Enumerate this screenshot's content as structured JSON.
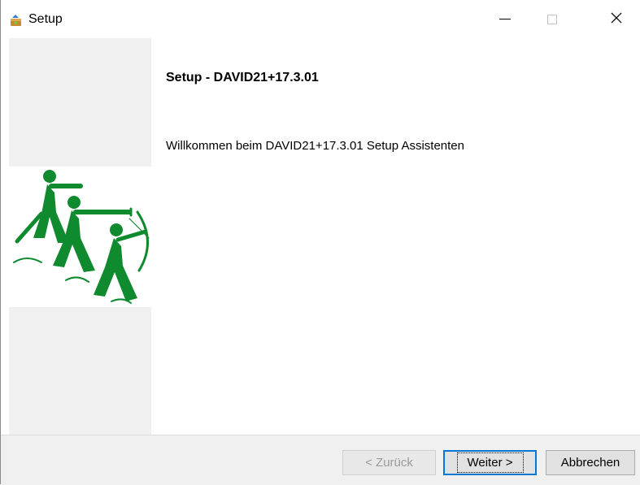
{
  "window": {
    "title": "Setup",
    "icon": "setup-app-icon",
    "controls": {
      "minimize": "minimize-icon",
      "maximize": "maximize-icon",
      "close": "close-icon",
      "close_glyph": "✕"
    }
  },
  "main": {
    "title": "Setup - DAVID21+17.3.01",
    "welcome": "Willkommen beim DAVID21+17.3.01 Setup Assistenten"
  },
  "sidebar": {
    "logo": "archers-logo-icon",
    "logo_color": "#0f8a2e"
  },
  "buttons": {
    "back": "< Zurück",
    "next": "Weiter >",
    "cancel": "Abbrechen"
  },
  "colors": {
    "focus_border": "#0078d7",
    "panel_bg": "#f0f0f0"
  }
}
